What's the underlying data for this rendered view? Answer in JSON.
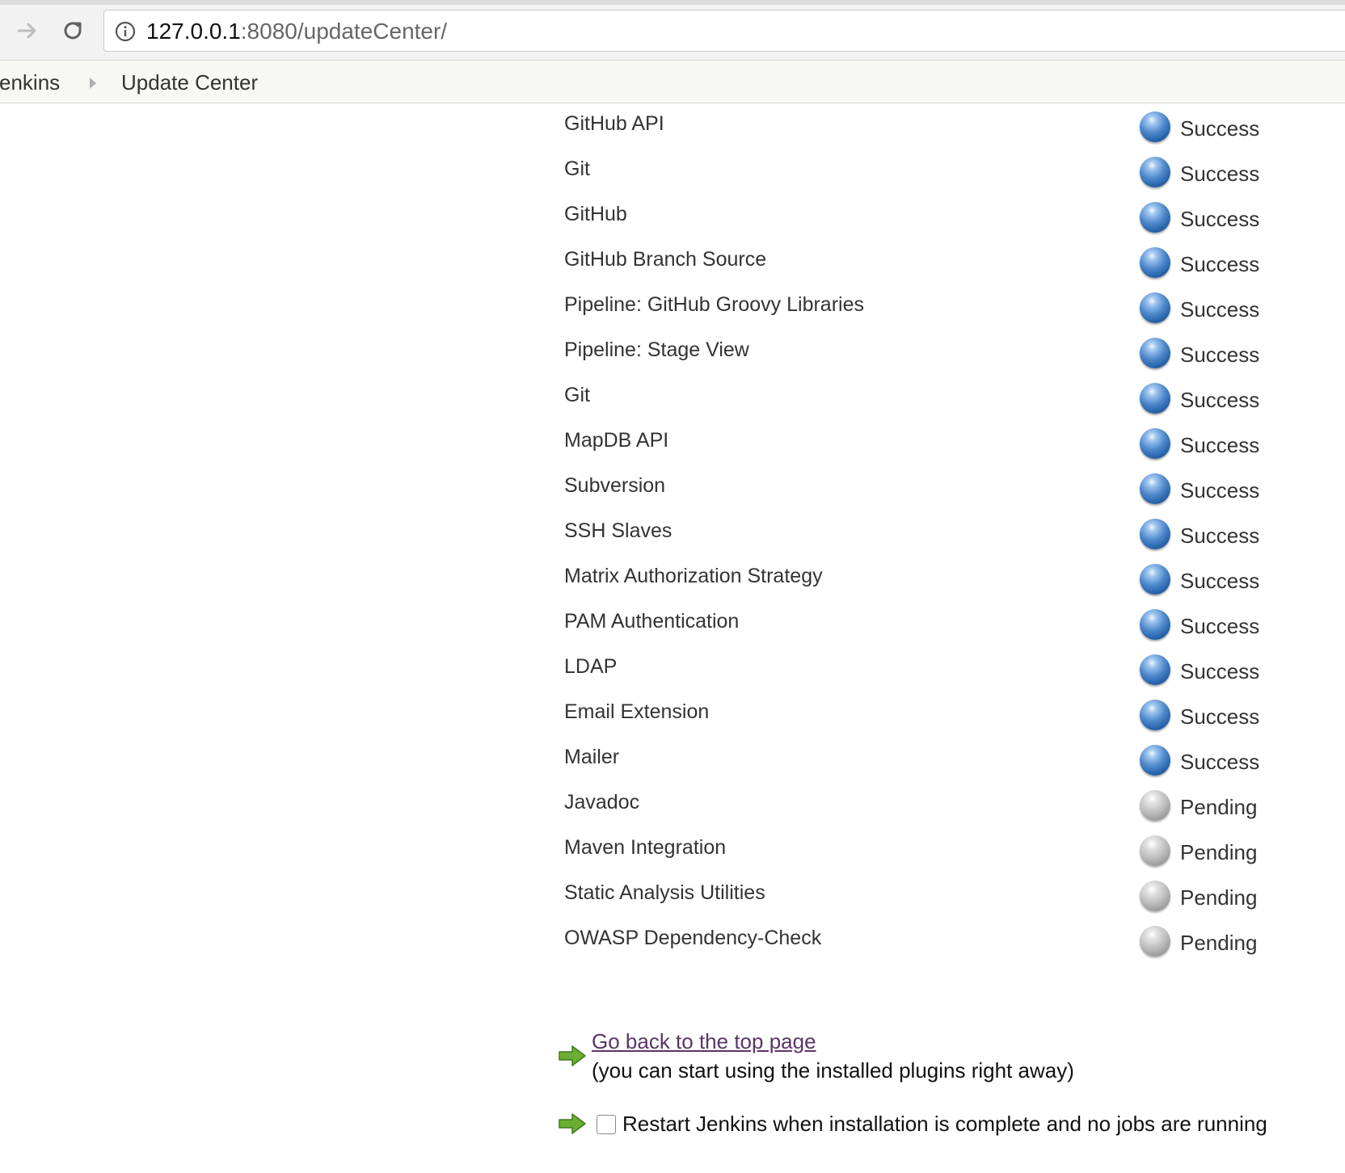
{
  "browser": {
    "url_host": "127.0.0.1",
    "url_rest": ":8080/updateCenter/"
  },
  "breadcrumb": {
    "items": [
      {
        "label": "Jenkins"
      },
      {
        "label": "Update Center"
      }
    ]
  },
  "plugins": [
    {
      "name": "GitHub API",
      "status": "Success"
    },
    {
      "name": "Git",
      "status": "Success"
    },
    {
      "name": "GitHub",
      "status": "Success"
    },
    {
      "name": "GitHub Branch Source",
      "status": "Success"
    },
    {
      "name": "Pipeline: GitHub Groovy Libraries",
      "status": "Success"
    },
    {
      "name": "Pipeline: Stage View",
      "status": "Success"
    },
    {
      "name": "Git",
      "status": "Success"
    },
    {
      "name": "MapDB API",
      "status": "Success"
    },
    {
      "name": "Subversion",
      "status": "Success"
    },
    {
      "name": "SSH Slaves",
      "status": "Success"
    },
    {
      "name": "Matrix Authorization Strategy",
      "status": "Success"
    },
    {
      "name": "PAM Authentication",
      "status": "Success"
    },
    {
      "name": "LDAP",
      "status": "Success"
    },
    {
      "name": "Email Extension",
      "status": "Success"
    },
    {
      "name": "Mailer",
      "status": "Success"
    },
    {
      "name": "Javadoc",
      "status": "Pending"
    },
    {
      "name": "Maven Integration",
      "status": "Pending"
    },
    {
      "name": "Static Analysis Utilities",
      "status": "Pending"
    },
    {
      "name": "OWASP Dependency-Check",
      "status": "Pending"
    }
  ],
  "footer": {
    "top_link": "Go back to the top page",
    "top_note": "(you can start using the installed plugins right away)",
    "restart_label": "Restart Jenkins when installation is complete and no jobs are running",
    "restart_checked": false
  },
  "colors": {
    "success": "#3f7fc4",
    "pending": "#b3b3b3",
    "link": "#5c3566",
    "arrow": "#5aa02c"
  },
  "icons": {
    "forward": "forward-arrow-icon",
    "reload": "reload-icon",
    "info": "info-icon",
    "separator": "breadcrumb-chevron-icon",
    "success": "blue-ball-icon",
    "pending": "grey-ball-icon",
    "action": "green-arrow-icon"
  }
}
